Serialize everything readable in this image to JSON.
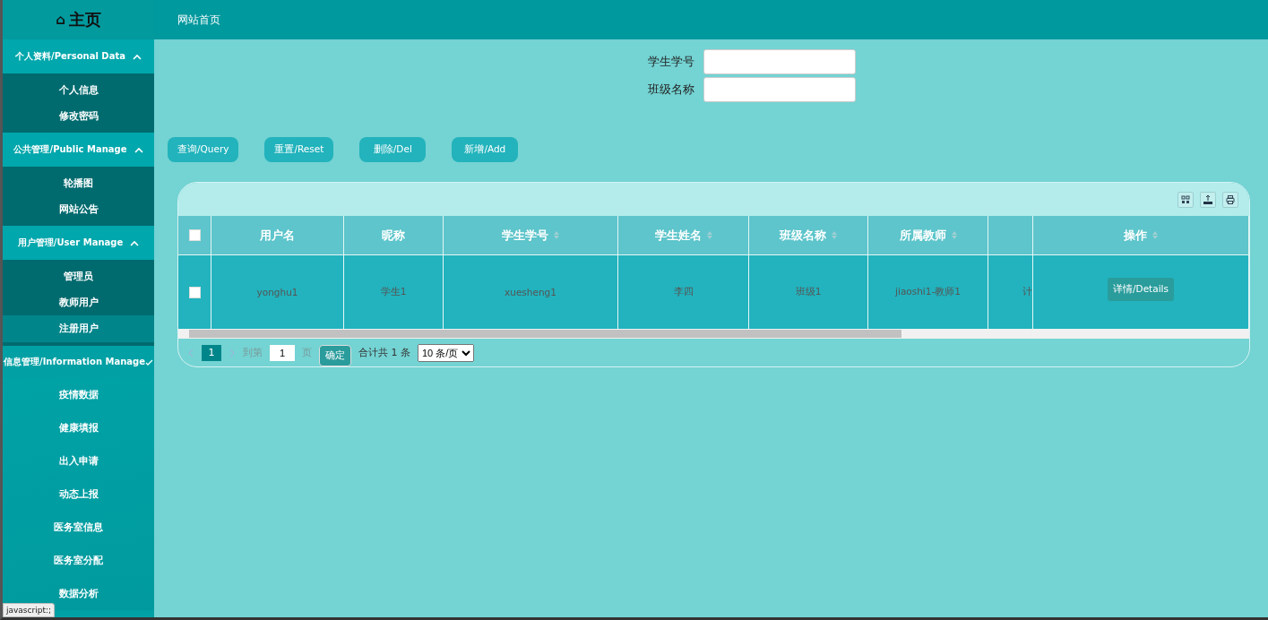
{
  "sidebar": {
    "home_icon": "⌂",
    "title": "主页",
    "groups": [
      {
        "label": "个人资料/Personal Data",
        "kind": "submenu",
        "items": [
          {
            "label": "个人信息",
            "highlighted": false
          },
          {
            "label": "修改密码",
            "highlighted": false
          }
        ]
      },
      {
        "label": "公共管理/Public Manage",
        "kind": "submenu",
        "items": [
          {
            "label": "轮播图",
            "highlighted": false
          },
          {
            "label": "网站公告",
            "highlighted": false
          }
        ]
      },
      {
        "label": "用户管理/User Manage",
        "kind": "submenu",
        "items": [
          {
            "label": "管理员",
            "highlighted": false
          },
          {
            "label": "教师用户",
            "highlighted": false
          },
          {
            "label": "注册用户",
            "highlighted": true
          }
        ]
      },
      {
        "label": "信息管理/Information Manage",
        "kind": "list",
        "items": [
          {
            "label": "疫情数据",
            "highlighted": false
          },
          {
            "label": "健康填报",
            "highlighted": false
          },
          {
            "label": "出入申请",
            "highlighted": false
          },
          {
            "label": "动态上报",
            "highlighted": false
          },
          {
            "label": "医务室信息",
            "highlighted": false
          },
          {
            "label": "医务室分配",
            "highlighted": false
          },
          {
            "label": "数据分析",
            "highlighted": false
          }
        ]
      }
    ]
  },
  "header": {
    "breadcrumb": "网站首页"
  },
  "search": {
    "fields": [
      {
        "label": "学生学号"
      },
      {
        "label": "班级名称"
      }
    ]
  },
  "actions": [
    "查询/Query",
    "重置/Reset",
    "删除/Del",
    "新增/Add"
  ],
  "table": {
    "select_all_checked": false,
    "columns": [
      {
        "key": "用户名",
        "sortable": false
      },
      {
        "key": "昵称",
        "sortable": false
      },
      {
        "key": "学生学号",
        "sortable": true
      },
      {
        "key": "学生姓名",
        "sortable": true
      },
      {
        "key": "班级名称",
        "sortable": true
      },
      {
        "key": "所属教师",
        "sortable": true
      },
      {
        "sortable": false
      },
      {
        "key": "操作",
        "sortable": true
      }
    ],
    "rows": [
      {
        "checked": false,
        "cells": [
          "yonghu1",
          "学生1",
          "xuesheng1",
          "李四",
          "班级1",
          "jiaoshi1-教师1",
          "计"
        ],
        "action": "详情/Details"
      }
    ]
  },
  "pagination": {
    "current": "1",
    "goto_label": "到第",
    "goto_value": "1",
    "page_label": "页",
    "confirm": "确定",
    "total": "合计共 1 条",
    "page_size": "10 条/页"
  },
  "status_bar": "javascript:;"
}
